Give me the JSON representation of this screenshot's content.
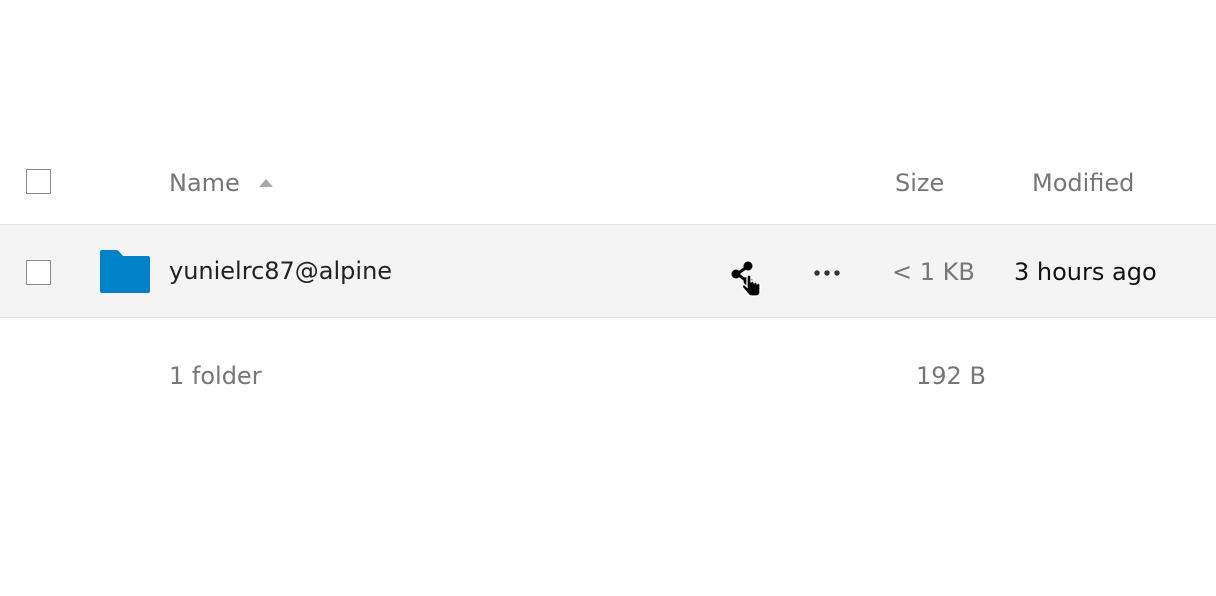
{
  "header": {
    "name_label": "Name",
    "size_label": "Size",
    "modified_label": "Modified",
    "sort": "name-ascending"
  },
  "rows": [
    {
      "name": "yunielrc87@alpine",
      "type": "folder",
      "icon": "folder-icon",
      "size": "< 1 KB",
      "modified": "3 hours ago",
      "selected": false
    }
  ],
  "summary": {
    "count_label": "1 folder",
    "total_size": "192 B"
  },
  "colors": {
    "folder": "#0082c9",
    "row_hover": "#f4f4f4",
    "muted_text": "#767676"
  }
}
